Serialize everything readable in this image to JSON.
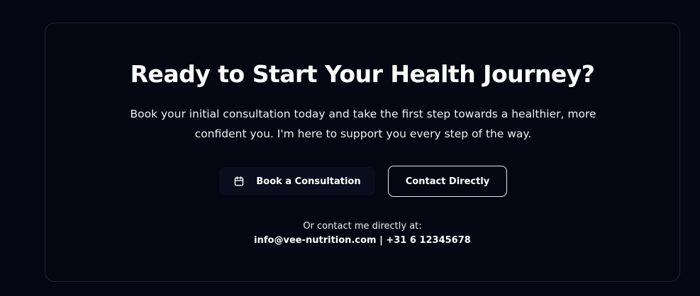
{
  "cta": {
    "title": "Ready to Start Your Health Journey?",
    "subtitle": "Book your initial consultation today and take the first step towards a healthier, more confident you. I'm here to support you every step of the way.",
    "book_button": {
      "label": "Book a Consultation",
      "icon": "calendar-icon"
    },
    "contact_button": {
      "label": "Contact Directly"
    },
    "contact_lead": "Or contact me directly at:",
    "email": "info@vee-nutrition.com",
    "separator": " | ",
    "phone": "+31 6 12345678"
  },
  "colors": {
    "page_background": "#050814",
    "card_background": "#040611",
    "card_border": "#1f2433",
    "text": "#ffffff",
    "book_button_background": "#090d1c",
    "contact_button_border": "#e6e8ee"
  }
}
